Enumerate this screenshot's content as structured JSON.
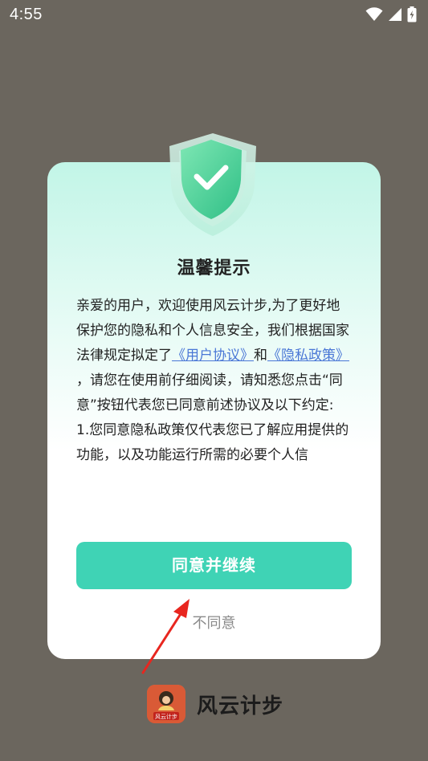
{
  "status_bar": {
    "time": "4:55",
    "icons": [
      "wifi-icon",
      "signal-icon",
      "battery-charging-icon"
    ]
  },
  "dialog": {
    "title": "温馨提示",
    "body": {
      "intro": "亲爱的用户，欢迎使用风云计步,为了更好地保护您的隐私和个人信息安全，我们根据国家法律规定拟定了",
      "user_agreement_link": "《用户协议》",
      "and": "和",
      "privacy_policy_link": "《隐私政策》",
      "para2": "，请您在使用前仔细阅读，请知悉您点击“同意”按钮代表您已同意前述协议及以下约定:",
      "item1": "1.您同意隐私政策仅代表您已了解应用提供的功能，以及功能运行所需的必要个人信"
    },
    "agree_button": "同意并继续",
    "disagree_link": "不同意"
  },
  "app": {
    "name": "风云计步",
    "logo_text": "风云计步"
  },
  "colors": {
    "accent": "#3fd3b5",
    "link": "#4a77d6",
    "backdrop": "#6b665e",
    "annotation_arrow": "#e8261f"
  }
}
